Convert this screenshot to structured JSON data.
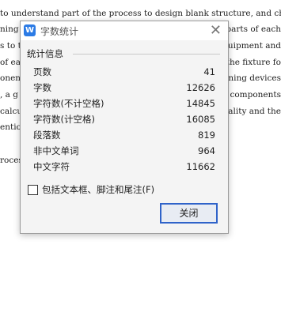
{
  "document": {
    "lines": [
      "to understand part of the process to design blank structure, and choose the",
      "ning c",
      "s to t",
      "of ea",
      "onent",
      ", a g",
      "calcul",
      "ention",
      "rocess"
    ],
    "right_fragments": [
      "e parts of each",
      "equipment and",
      "the fixture fo",
      "oning devices",
      "r components",
      "onality and the"
    ]
  },
  "dialog": {
    "title": "字数统计",
    "app_icon_glyph": "W",
    "close_glyph": "✕",
    "group_label": "统计信息",
    "stats": [
      {
        "label": "页数",
        "value": "41"
      },
      {
        "label": "字数",
        "value": "12626"
      },
      {
        "label": "字符数(不计空格)",
        "value": "14845"
      },
      {
        "label": "字符数(计空格)",
        "value": "16085"
      },
      {
        "label": "段落数",
        "value": "819"
      },
      {
        "label": "非中文单词",
        "value": "964"
      },
      {
        "label": "中文字符",
        "value": "11662"
      }
    ],
    "checkbox_label": "包括文本框、脚注和尾注(F)",
    "checkbox_checked": false,
    "close_button_label": "关闭",
    "accent_color": "#2f63c9"
  }
}
